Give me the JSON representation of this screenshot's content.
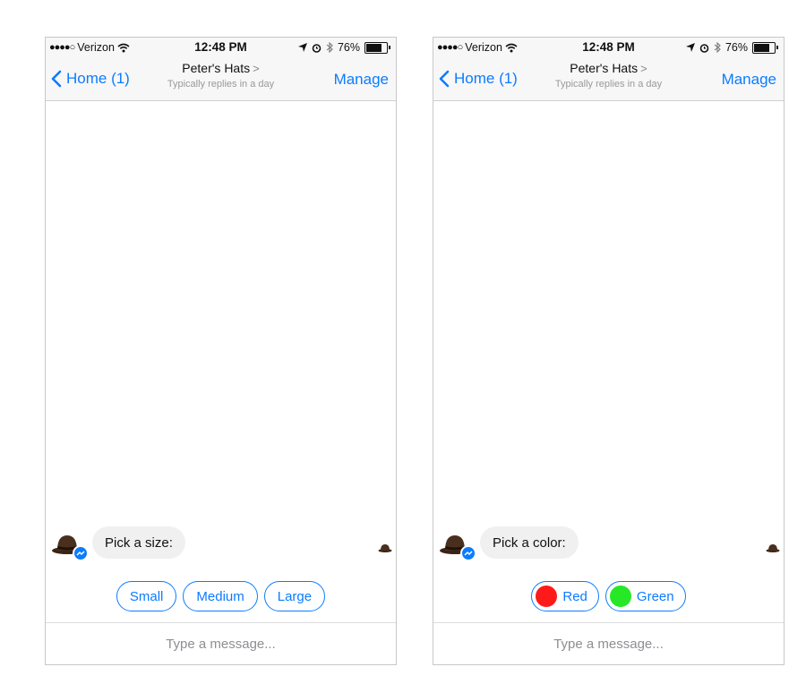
{
  "status_bar": {
    "carrier": "Verizon",
    "signal_dots": "●●●●○",
    "time": "12:48 PM",
    "battery": "76%",
    "battery_level": 0.76
  },
  "nav": {
    "back_label": "Home (1)",
    "title": "Peter's Hats",
    "title_chevron": ">",
    "subtitle": "Typically replies in a day",
    "manage_label": "Manage"
  },
  "screens": {
    "left": {
      "message": "Pick a size:",
      "quick_replies": [
        "Small",
        "Medium",
        "Large"
      ]
    },
    "right": {
      "message": "Pick a color:",
      "quick_replies": [
        {
          "label": "Red",
          "color": "#ff1a1a"
        },
        {
          "label": "Green",
          "color": "#27e827"
        }
      ]
    }
  },
  "composer": {
    "placeholder": "Type a message..."
  },
  "colors": {
    "accent": "#0c7cff",
    "bubble": "#f0f0f0"
  }
}
